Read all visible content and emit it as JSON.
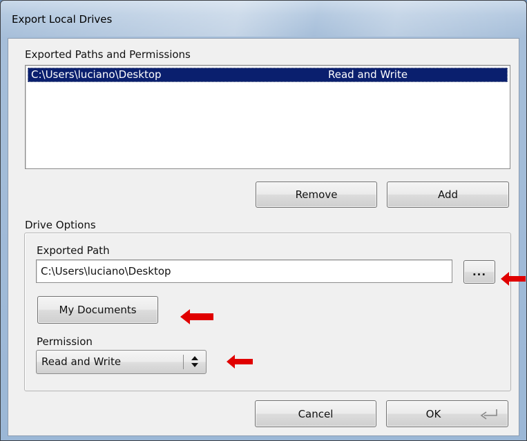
{
  "window": {
    "title": "Export Local Drives"
  },
  "exported": {
    "section_label": "Exported Paths and Permissions",
    "rows": [
      {
        "path": "C:\\Users\\luciano\\Desktop",
        "permission": "Read and Write"
      }
    ],
    "remove_label": "Remove",
    "add_label": "Add"
  },
  "drive_options": {
    "section_label": "Drive Options",
    "path_label": "Exported Path",
    "path_value": "C:\\Users\\luciano\\Desktop",
    "browse_label": "...",
    "my_documents_label": "My Documents",
    "permission_label": "Permission",
    "permission_value": "Read and Write"
  },
  "footer": {
    "cancel_label": "Cancel",
    "ok_label": "OK"
  },
  "colors": {
    "selection": "#0a1f6e",
    "annotation_arrow": "#e00000"
  },
  "icons": {
    "enter": "enter-key-icon",
    "updown": "updown-arrows-icon",
    "annotation": "red-arrow-icon"
  }
}
